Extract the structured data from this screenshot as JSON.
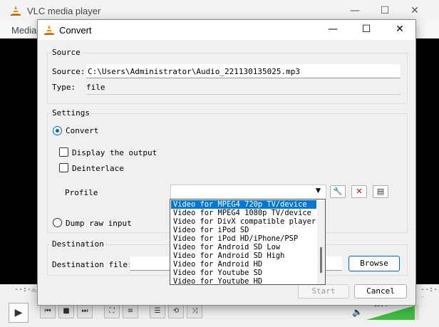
{
  "vlc": {
    "title": "VLC media player",
    "menu_partial": "Media",
    "seek_left": "--:--",
    "seek_right": "--:--",
    "volume": "100%"
  },
  "dialog": {
    "title": "Convert",
    "source": {
      "group_label": "Source",
      "source_label": "Source:",
      "source_value": "C:\\Users\\Administrator\\Audio_221130135025.mp3",
      "type_label": "Type:",
      "type_value": "file"
    },
    "settings": {
      "group_label": "Settings",
      "convert_label": "Convert",
      "display_output_label": "Display the output",
      "deinterlace_label": "Deinterlace",
      "profile_label": "Profile",
      "dump_raw_label": "Dump raw input"
    },
    "profile_options": [
      "Video for MPEG4 720p TV/device",
      "Video for MPEG4 1080p TV/device",
      "Video for DivX compatible player",
      "Video for iPod SD",
      "Video for iPod HD/iPhone/PSP",
      "Video for Android SD Low",
      "Video for Android SD High",
      "Video for Android HD",
      "Video for Youtube SD",
      "Video for Youtube HD"
    ],
    "destination": {
      "group_label": "Destination",
      "file_label": "Destination file:",
      "file_value": "",
      "browse_label": "Browse"
    },
    "start_label": "Start",
    "cancel_label": "Cancel"
  },
  "colors": {
    "accent": "#0067c0",
    "selection": "#0078d7",
    "vlc_orange": "#f08c00"
  }
}
